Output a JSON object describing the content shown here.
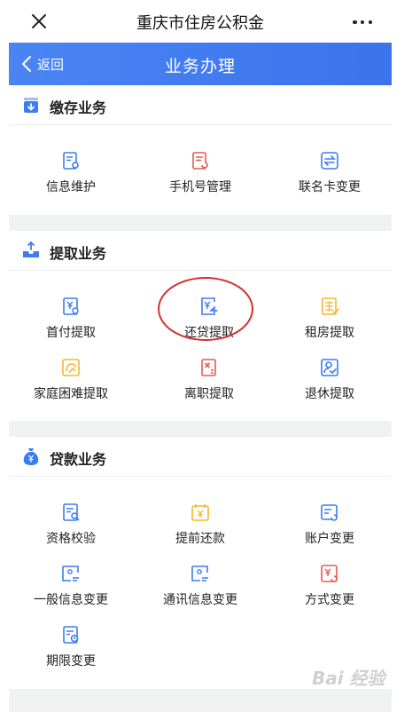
{
  "window": {
    "title": "重庆市住房公积金",
    "close_icon": "close-x-icon",
    "more_icon": "more-dots-icon"
  },
  "appbar": {
    "back_label": "返回",
    "title": "业务办理"
  },
  "sections": {
    "deposit": {
      "title": "缴存业务",
      "items": [
        {
          "label": "信息维护",
          "icon": "doc-gear-icon"
        },
        {
          "label": "手机号管理",
          "icon": "doc-refresh-icon"
        },
        {
          "label": "联名卡变更",
          "icon": "card-exchange-icon"
        }
      ]
    },
    "withdraw": {
      "title": "提取业务",
      "items": [
        {
          "label": "首付提取",
          "icon": "yen-doc-icon"
        },
        {
          "label": "还贷提取",
          "icon": "yen-return-icon"
        },
        {
          "label": "租房提取",
          "icon": "rent-doc-icon"
        },
        {
          "label": "家庭困难提取",
          "icon": "help-hand-icon"
        },
        {
          "label": "离职提取",
          "icon": "resign-doc-icon"
        },
        {
          "label": "退休提取",
          "icon": "retire-person-icon"
        }
      ]
    },
    "loan": {
      "title": "贷款业务",
      "items": [
        {
          "label": "资格校验",
          "icon": "qualify-doc-icon"
        },
        {
          "label": "提前还款",
          "icon": "calendar-yen-icon"
        },
        {
          "label": "账户变更",
          "icon": "account-change-icon"
        },
        {
          "label": "一般信息变更",
          "icon": "info-change-icon"
        },
        {
          "label": "通讯信息变更",
          "icon": "contact-change-icon"
        },
        {
          "label": "方式变更",
          "icon": "method-change-icon"
        },
        {
          "label": "期限变更",
          "icon": "term-clock-icon"
        }
      ]
    }
  },
  "watermark": "Bai 经验",
  "colors": {
    "blue": "#3d7cf0",
    "red": "#e45b50",
    "orange": "#f2b731",
    "highlight": "#d42f2f"
  }
}
